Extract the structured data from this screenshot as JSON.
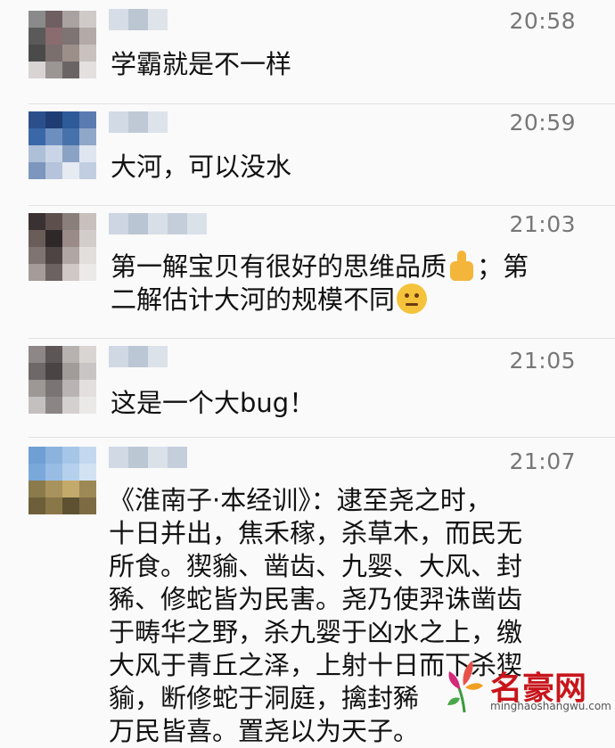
{
  "messages": [
    {
      "time": "20:58",
      "text": "学霸就是不一样",
      "avatar_colors": [
        "#6a6a6a",
        "#8a6b6e",
        "#4a4a4a",
        "#9c8f8a"
      ]
    },
    {
      "time": "20:59",
      "text": "大河，可以没水",
      "avatar_colors": [
        "#2c4f8c",
        "#5a7bb0",
        "#1f3d73",
        "#8fa7c8"
      ]
    },
    {
      "time": "21:03",
      "text_part1": "第一解宝贝有很好的思维品质",
      "text_part2": "；第",
      "text_line2": "二解估计大河的规模不同",
      "avatar_colors": [
        "#3a3232",
        "#6a5c59",
        "#9a8b88",
        "#c7c0bd"
      ]
    },
    {
      "time": "21:05",
      "text": "这是一个大bug！",
      "avatar_colors": [
        "#5d5656",
        "#8d8787",
        "#b7b2b0",
        "#d9d5d3"
      ]
    },
    {
      "time": "21:07",
      "lines": [
        "《淮南子·本经训》：逮至尧之时，",
        "十日并出，焦禾稼，杀草木，而民无",
        "所食。猰貐、凿齿、九婴、大风、封",
        "豨、修蛇皆为民害。尧乃使羿诛凿齿",
        "于畴华之野，杀九婴于凶水之上，缴",
        "大风于青丘之泽，上射十日而下杀猰",
        "貐，断修蛇于洞庭，擒封豨",
        "万民皆喜。置尧以为天子。"
      ],
      "avatar_colors": [
        "#6f9fd4",
        "#a6c6e8",
        "#8a7a4c",
        "#c4aa6a"
      ]
    }
  ],
  "watermark": {
    "title": "名豪网",
    "subtitle": "minghaoshangwu.com"
  }
}
